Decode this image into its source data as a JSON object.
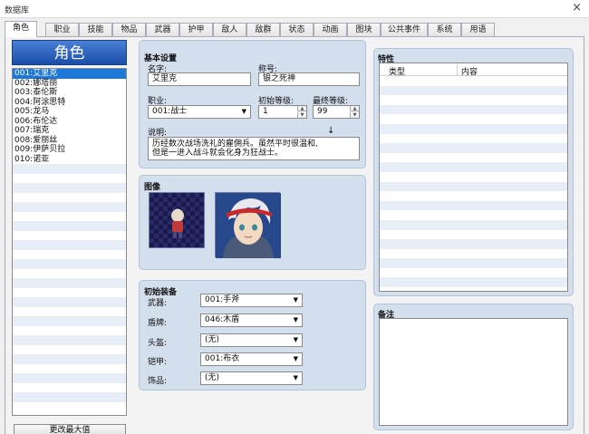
{
  "window": {
    "title": "数据库",
    "close_glyph": "×"
  },
  "tabs": [
    "角色",
    "职业",
    "技能",
    "物品",
    "武器",
    "护甲",
    "敌人",
    "敌群",
    "状态",
    "动画",
    "图块",
    "公共事件",
    "系统",
    "用语"
  ],
  "left": {
    "header": "角色",
    "items": [
      "001:艾里克",
      "002:娜塔丽",
      "003:泰伦斯",
      "004:阿涂思特",
      "005:龙马",
      "006:布伦达",
      "007:瑞克",
      "008:爱丽丝",
      "009:伊萨贝拉",
      "010:诺亚"
    ],
    "button": "更改最大值"
  },
  "basic": {
    "title": "基本设置",
    "name_label": "名字:",
    "name_value": "艾里克",
    "nickname_label": "称号:",
    "nickname_value": "银之死神",
    "class_label": "职业:",
    "class_value": "001:战士",
    "init_level_label": "初始等级:",
    "init_level_value": "1",
    "max_level_label": "最终等级:",
    "max_level_value": "99",
    "profile_label": "说明:",
    "profile_line1": "历经数次战场洗礼的雇佣兵。虽然平时很温和,",
    "profile_line2": "但是一进入战斗就会化身为狂战士。",
    "cursor_glyph": "↓"
  },
  "image": {
    "title": "图像"
  },
  "equip": {
    "title": "初始装备",
    "rows": [
      {
        "label": "武器:",
        "value": "001:手斧"
      },
      {
        "label": "盾牌:",
        "value": "046:木盾"
      },
      {
        "label": "头盔:",
        "value": "(无)"
      },
      {
        "label": "铠甲:",
        "value": "001:布衣"
      },
      {
        "label": "饰品:",
        "value": "(无)"
      }
    ]
  },
  "traits": {
    "title": "特性",
    "col_type": "类型",
    "col_content": "内容"
  },
  "notes": {
    "title": "备注"
  }
}
